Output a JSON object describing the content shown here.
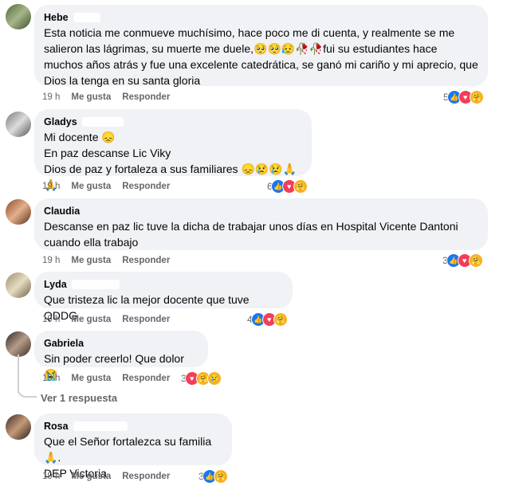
{
  "comments": [
    {
      "name": "Hebe",
      "text": "Esta noticia me conmueve muchísimo, hace poco me di cuenta, y realmente se me salieron las lágrimas, su muerte me duele,🥺🥺😥🥀🥀fui su estudiantes hace muchos años atrás y fue una excelente catedrática, se ganó mi cariño y mi aprecio, que Dios la tenga en su santa gloria",
      "time": "19 h",
      "like": "Me gusta",
      "reply": "Responder",
      "count": "5",
      "reactions": [
        "like-icon",
        "love-icon",
        "care-icon"
      ]
    },
    {
      "name": "Gladys",
      "text": "Mi docente 😞\nEn paz descanse Lic Viky\nDios de paz y fortaleza a sus familiares 😞😢😢🙏🙏",
      "time": "19 h",
      "like": "Me gusta",
      "reply": "Responder",
      "count": "6",
      "reactions": [
        "like-icon",
        "love-icon",
        "care-icon"
      ]
    },
    {
      "name": "Claudia",
      "text": "Descanse en paz lic tuve la dicha de trabajar unos días en Hospital Vicente Dantoni cuando ella trabajo",
      "time": "19 h",
      "like": "Me gusta",
      "reply": "Responder",
      "count": "3",
      "reactions": [
        "like-icon",
        "love-icon",
        "care-icon"
      ]
    },
    {
      "name": "Lyda",
      "text": "Que tristeza lic la mejor docente que tuve QDDG",
      "time": "19 h",
      "like": "Me gusta",
      "reply": "Responder",
      "count": "4",
      "reactions": [
        "like-icon",
        "love-icon",
        "care-icon"
      ]
    },
    {
      "name": "Gabriela",
      "text": "Sin poder creerlo! Que dolor 😭",
      "time": "19 h",
      "like": "Me gusta",
      "reply": "Responder",
      "count": "3",
      "reactions": [
        "love-icon",
        "care-icon",
        "sad-icon"
      ]
    },
    {
      "name": "Rosa",
      "text": "Que el Señor fortalezca su familia🙏.\nDEP Victoria",
      "time": "19 h",
      "like": "Me gusta",
      "reply": "Responder",
      "count": "3",
      "reactions": [
        "like-icon",
        "care-icon"
      ]
    }
  ],
  "see_replies": "Ver 1 respuesta",
  "colors": {
    "bubble": "#f0f2f5",
    "meta": "#65676b",
    "like": "#1877f2",
    "love": "#f33e58",
    "care": "#f7b125"
  }
}
